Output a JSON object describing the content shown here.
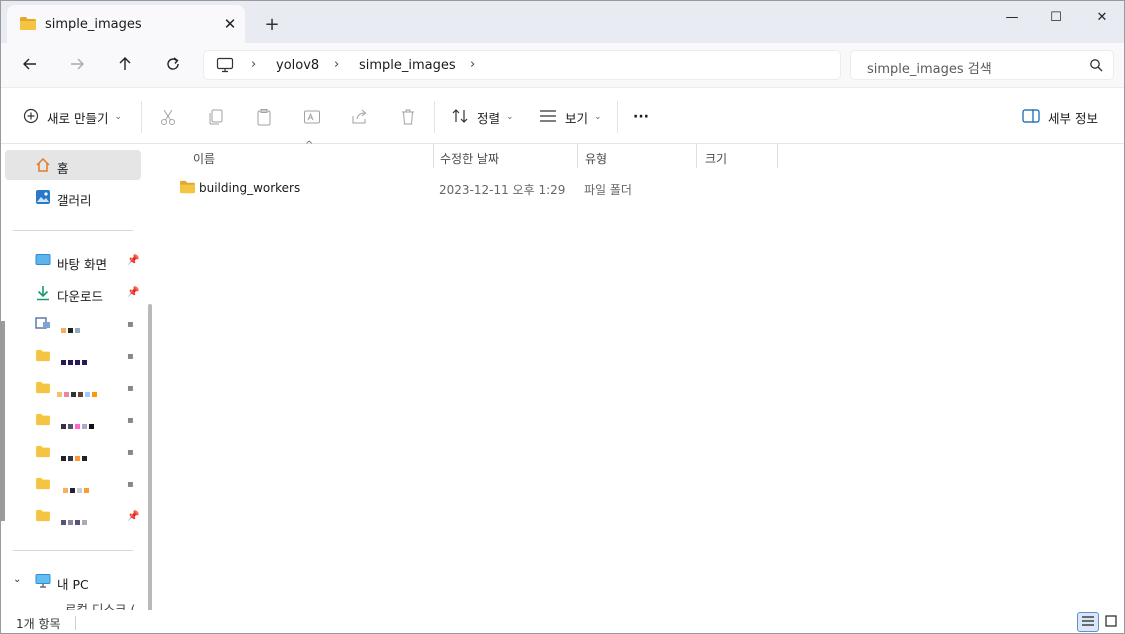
{
  "tab": {
    "title": "simple_images",
    "close": "✕",
    "new_tab": "+"
  },
  "window_controls": {
    "minimize": "—",
    "maximize": "☐",
    "close": "✕"
  },
  "address": {
    "crumbs": [
      "yolov8",
      "simple_images"
    ],
    "sep": "›",
    "search_placeholder": "simple_images 검색"
  },
  "commands": {
    "new_label": "새로 만들기",
    "sort_label": "정렬",
    "view_label": "보기",
    "more_label": "···",
    "details_label": "세부 정보"
  },
  "sidebar": {
    "home": "홈",
    "gallery": "갤러리",
    "desktop": "바탕 화면",
    "downloads": "다운로드",
    "this_pc": "내 PC",
    "local_disk_partial": "로컬 디스크 ("
  },
  "columns": {
    "name": "이름",
    "modified": "수정한 날짜",
    "type": "유형",
    "size": "크기"
  },
  "files": [
    {
      "name": "building_workers",
      "modified": "2023-12-11 오후 1:29",
      "type": "파일 폴더"
    }
  ],
  "status": {
    "item_count": "1개 항목"
  },
  "colors": {
    "folder": "#f4c542",
    "folder_dark": "#e0a82e",
    "accent": "#0b5cad"
  }
}
